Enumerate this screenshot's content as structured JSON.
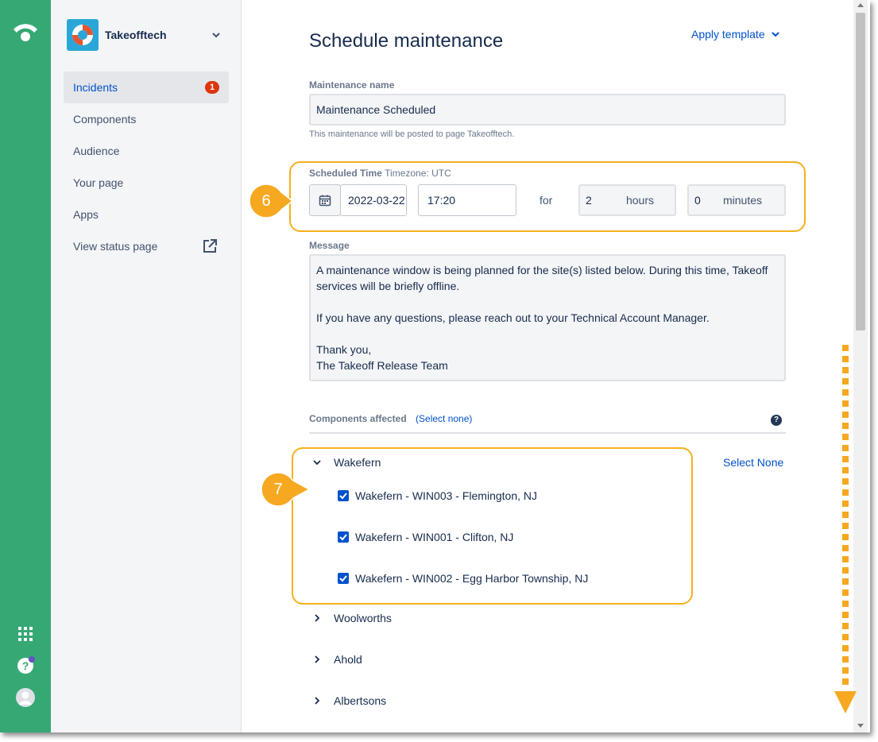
{
  "rail": {
    "logo_icon": "statuspage-logo-icon",
    "bottom_icons": [
      "apps-grid-icon",
      "help-icon",
      "avatar-icon"
    ],
    "accent": "#36a874"
  },
  "sidebar": {
    "org_name": "Takeofftech",
    "items": [
      {
        "label": "Incidents",
        "badge": "1",
        "active": true
      },
      {
        "label": "Components"
      },
      {
        "label": "Audience"
      },
      {
        "label": "Your page"
      },
      {
        "label": "Apps"
      },
      {
        "label": "View status page",
        "icon": "external-link-icon"
      }
    ]
  },
  "main": {
    "title": "Schedule maintenance",
    "apply_template": "Apply template",
    "maintenance_name_label": "Maintenance name",
    "maintenance_name_value": "Maintenance Scheduled",
    "maintenance_help": "This maintenance will be posted to page Takeofftech.",
    "scheduled_time_label": "Scheduled Time",
    "timezone_label": "Timezone: UTC",
    "date_value": "2022-03-22",
    "time_value": "17:20",
    "for_label": "for",
    "hours_value": "2",
    "hours_unit": "hours",
    "minutes_value": "0",
    "minutes_unit": "minutes",
    "message_label": "Message",
    "message_lines": [
      "A maintenance window is being planned for the site(s) listed below. During this time, Takeoff services will be briefly offline.",
      "If you have any questions, please reach out to your Technical Account Manager.",
      "Thank you,",
      "The Takeoff Release Team"
    ],
    "components_label": "Components affected",
    "components_select_none": "(Select none)",
    "group_select_none": "Select None",
    "groups": [
      {
        "name": "Wakefern",
        "expanded": true,
        "components": [
          "Wakefern - WIN003 - Flemington, NJ",
          "Wakefern - WIN001 - Clifton, NJ",
          "Wakefern - WIN002 - Egg Harbor Township, NJ"
        ]
      },
      {
        "name": "Woolworths",
        "expanded": false
      },
      {
        "name": "Ahold",
        "expanded": false
      },
      {
        "name": "Albertsons",
        "expanded": false
      }
    ]
  },
  "annotations": {
    "step_a": "6",
    "step_b": "7",
    "color": "#f6b01e"
  },
  "colors": {
    "link": "#0052cc",
    "badge": "#de350b",
    "checkbox": "#0052cc"
  }
}
